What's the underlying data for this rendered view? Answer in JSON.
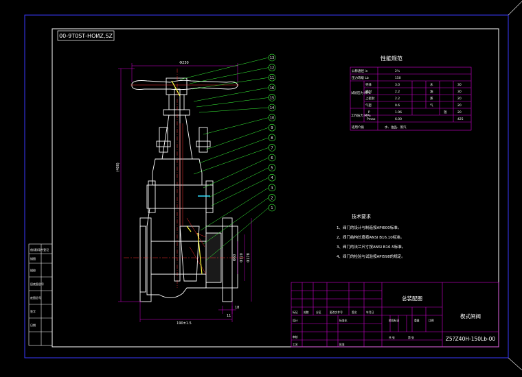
{
  "drawing_code": "Z15?Z40H-150Lb-00",
  "drawing_code_top": "00-9Т0ЅТ-НОИΖ‚ЅΖ",
  "title_block": {
    "assembly_title": "总装配图",
    "part_name": "楔式闸阀",
    "code": "Z5?Z40H-150Lb-00",
    "small_cells": [
      "标记",
      "处数",
      "分区",
      "更改文件号",
      "签名",
      "年月日",
      "设计",
      "标准化",
      "审核",
      "工艺",
      "批准",
      "阶段标记",
      "重量",
      "比例",
      "共 张",
      "第 张"
    ]
  },
  "side_table": {
    "rows": [
      "借(通)用件登记",
      "描图",
      "描校",
      "旧底图总号",
      "底图总号",
      "签字",
      "日期"
    ]
  },
  "perf_table": {
    "title": "性能规范",
    "rows": [
      [
        "公称通径 in",
        "2½",
        ""
      ],
      [
        "压力等级 Lb",
        "150",
        ""
      ],
      [
        "",
        "壳体",
        "3.0"
      ],
      [
        "试验压力 MPa",
        "密封",
        "2.2"
      ],
      [
        "",
        "上密封",
        "2.2"
      ],
      [
        "",
        "气密",
        "0.6"
      ],
      [
        "工作压力 MPa",
        "P",
        "1.96"
      ],
      [
        "",
        "Pmax",
        "6.00"
      ],
      [
        "适用介质",
        "水、油品、蒸汽",
        ""
      ]
    ],
    "right_values": [
      "30",
      "30",
      "20",
      "20",
      "20",
      "425"
    ],
    "right_labels": [
      "水",
      "油",
      "蒸",
      "气",
      "温"
    ]
  },
  "tech_req": {
    "title": "技术要求",
    "items": [
      "1、阀门的设计与制造按API600标准。",
      "2、阀门结构长度按ANSI B16.10标准。",
      "3、阀门的法兰尺寸按ANSI B16.5标准。",
      "4、阀门的检验与试验按API598的规定。"
    ]
  },
  "balloons": [
    "13",
    "12",
    "11",
    "16",
    "15",
    "14",
    "10",
    "9",
    "8",
    "7",
    "6",
    "5",
    "4",
    "3",
    "2",
    "1"
  ],
  "dimensions": {
    "handwheel": "Φ230",
    "height": "(400)",
    "length": "190±1.5",
    "d1": "Φ60",
    "d2": "Φ120",
    "d3": "Φ178",
    "t": "18",
    "b": "11"
  },
  "colors": {
    "frame": "#ffffff",
    "border": "#2a2aff",
    "table": "#d400d4",
    "leader": "#3aff3a",
    "part": "#ffffff",
    "section": "#ff3030",
    "dim": "#d400d4",
    "text": "#ffffff"
  }
}
